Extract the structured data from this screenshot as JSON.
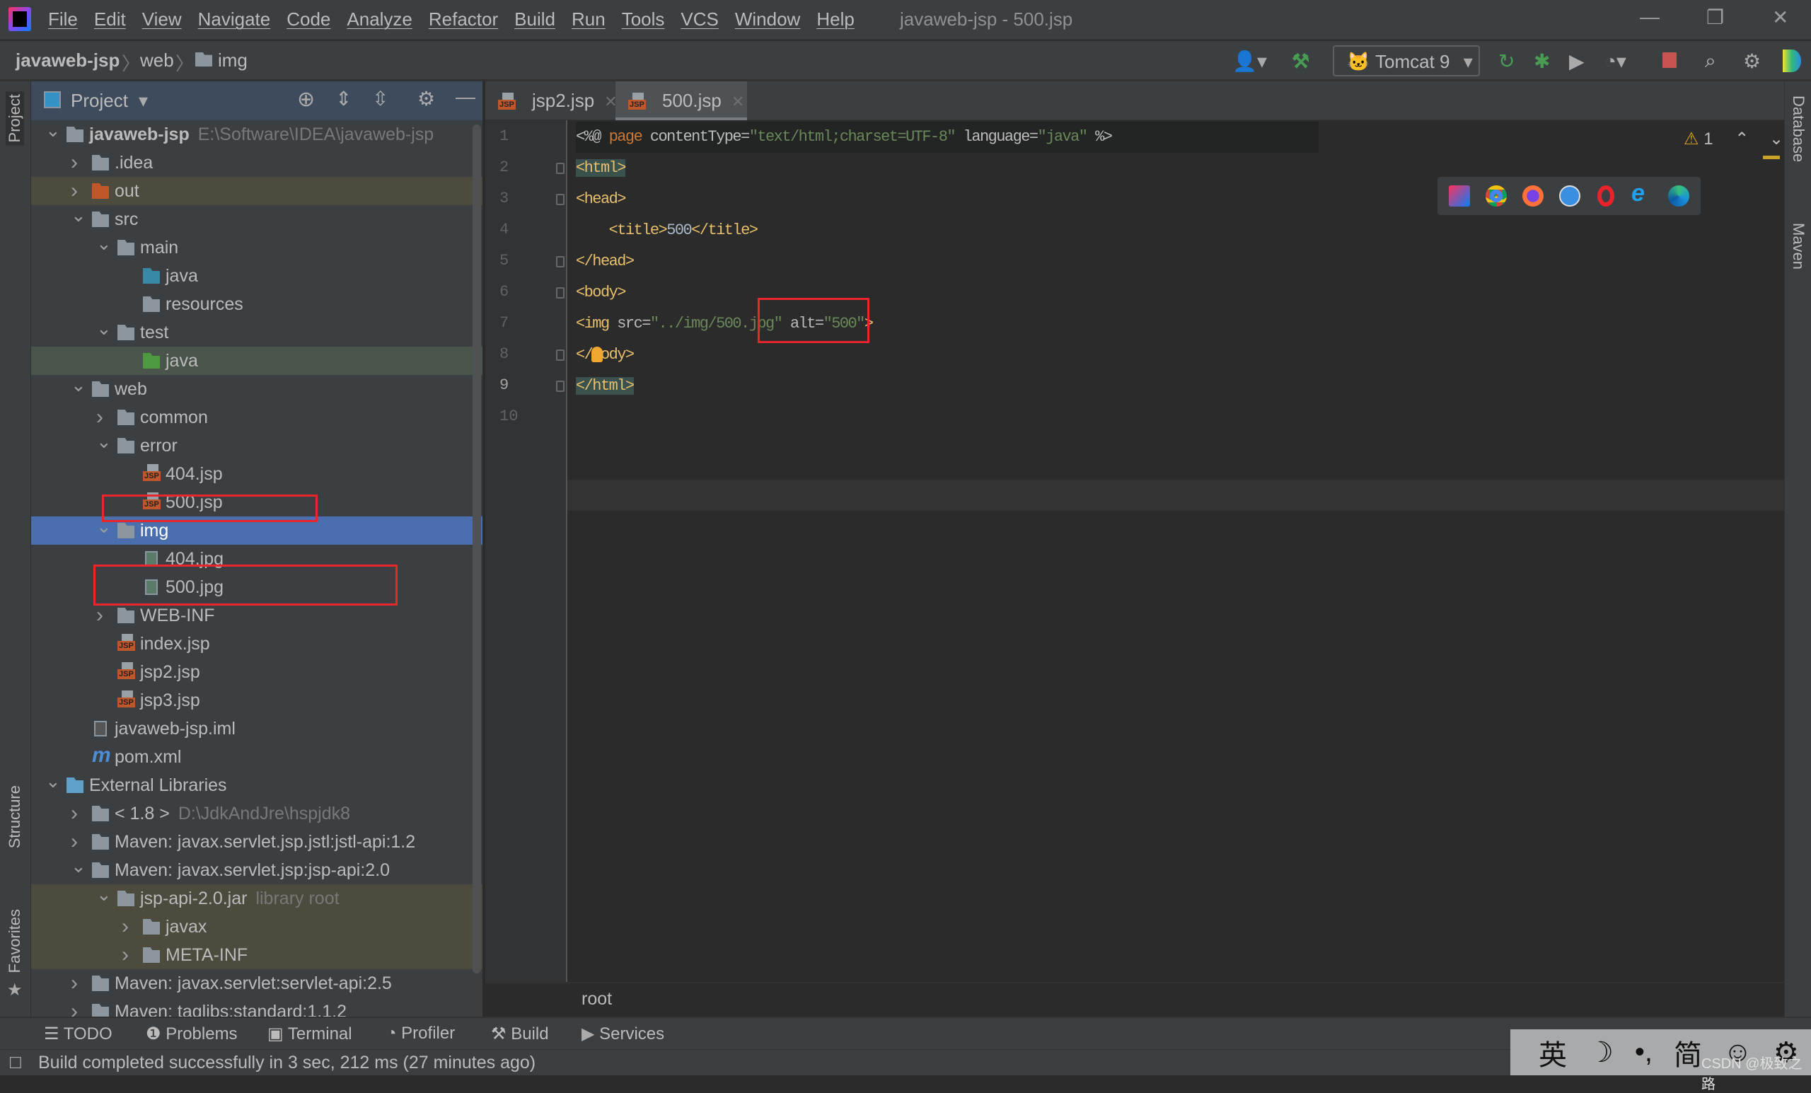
{
  "app": {
    "title": "javaweb-jsp - 500.jsp",
    "menu": [
      "File",
      "Edit",
      "View",
      "Navigate",
      "Code",
      "Analyze",
      "Refactor",
      "Build",
      "Run",
      "Tools",
      "VCS",
      "Window",
      "Help"
    ]
  },
  "breadcrumb": [
    "javaweb-jsp",
    "web",
    "img"
  ],
  "toolbar": {
    "run_config": "Tomcat 9"
  },
  "side_left": [
    "Project",
    "Structure",
    "Favorites"
  ],
  "side_right": [
    "Database",
    "Maven"
  ],
  "project_panel": {
    "title": "Project"
  },
  "tree": [
    {
      "label": "javaweb-jsp",
      "hint": "E:\\Software\\IDEA\\javaweb-jsp",
      "level": 0,
      "arrow": "open",
      "icon": "module-folder",
      "bold": true
    },
    {
      "label": ".idea",
      "level": 1,
      "arrow": "closed",
      "icon": "folder"
    },
    {
      "label": "out",
      "level": 1,
      "arrow": "closed",
      "icon": "excluded-folder",
      "highlight": "brown"
    },
    {
      "label": "src",
      "level": 1,
      "arrow": "open",
      "icon": "folder"
    },
    {
      "label": "main",
      "level": 2,
      "arrow": "open",
      "icon": "folder"
    },
    {
      "label": "java",
      "level": 3,
      "arrow": "",
      "icon": "source-folder"
    },
    {
      "label": "resources",
      "level": 3,
      "arrow": "",
      "icon": "resources-folder"
    },
    {
      "label": "test",
      "level": 2,
      "arrow": "open",
      "icon": "folder"
    },
    {
      "label": "java",
      "level": 3,
      "arrow": "",
      "icon": "test-folder",
      "highlight": "green"
    },
    {
      "label": "web",
      "level": 1,
      "arrow": "open",
      "icon": "web-folder"
    },
    {
      "label": "common",
      "level": 2,
      "arrow": "closed",
      "icon": "folder"
    },
    {
      "label": "error",
      "level": 2,
      "arrow": "open",
      "icon": "folder"
    },
    {
      "label": "404.jsp",
      "level": 3,
      "arrow": "",
      "icon": "jsp-file"
    },
    {
      "label": "500.jsp",
      "level": 3,
      "arrow": "",
      "icon": "jsp-file"
    },
    {
      "label": "img",
      "level": 2,
      "arrow": "open",
      "icon": "folder",
      "highlight": "selected"
    },
    {
      "label": "404.jpg",
      "level": 3,
      "arrow": "",
      "icon": "image-file"
    },
    {
      "label": "500.jpg",
      "level": 3,
      "arrow": "",
      "icon": "image-file"
    },
    {
      "label": "WEB-INF",
      "level": 2,
      "arrow": "closed",
      "icon": "folder"
    },
    {
      "label": "index.jsp",
      "level": 2,
      "arrow": "",
      "icon": "jsp-file"
    },
    {
      "label": "jsp2.jsp",
      "level": 2,
      "arrow": "",
      "icon": "jsp-file"
    },
    {
      "label": "jsp3.jsp",
      "level": 2,
      "arrow": "",
      "icon": "jsp-file"
    },
    {
      "label": "javaweb-jsp.iml",
      "level": 1,
      "arrow": "",
      "icon": "iml-file"
    },
    {
      "label": "pom.xml",
      "level": 1,
      "arrow": "",
      "icon": "maven-file"
    },
    {
      "label": "External Libraries",
      "level": 0,
      "arrow": "open",
      "icon": "libraries"
    },
    {
      "label": "< 1.8 >",
      "hint": "D:\\JdkAndJre\\hspjdk8",
      "level": 1,
      "arrow": "closed",
      "icon": "jdk"
    },
    {
      "label": "Maven: javax.servlet.jsp.jstl:jstl-api:1.2",
      "level": 1,
      "arrow": "closed",
      "icon": "library"
    },
    {
      "label": "Maven: javax.servlet.jsp:jsp-api:2.0",
      "level": 1,
      "arrow": "open",
      "icon": "library"
    },
    {
      "label": "jsp-api-2.0.jar",
      "hint": "library root",
      "level": 2,
      "arrow": "open",
      "icon": "jar",
      "highlight": "brown"
    },
    {
      "label": "javax",
      "level": 3,
      "arrow": "closed",
      "icon": "folder",
      "highlight": "brown"
    },
    {
      "label": "META-INF",
      "level": 3,
      "arrow": "closed",
      "icon": "folder",
      "highlight": "brown"
    },
    {
      "label": "Maven: javax.servlet:servlet-api:2.5",
      "level": 1,
      "arrow": "closed",
      "icon": "library"
    },
    {
      "label": "Maven: taglibs:standard:1.1.2",
      "level": 1,
      "arrow": "closed",
      "icon": "library"
    }
  ],
  "tabs": [
    {
      "label": "jsp2.jsp",
      "active": false
    },
    {
      "label": "500.jsp",
      "active": true
    }
  ],
  "editor": {
    "warnings": "1",
    "lines": [
      [
        [
          "<%@ ",
          "dir"
        ],
        [
          "page",
          "kw"
        ],
        [
          " contentType=",
          "dir"
        ],
        [
          "\"text/html;charset=UTF-8\"",
          "str"
        ],
        [
          " language=",
          "dir"
        ],
        [
          "\"java\"",
          "str"
        ],
        [
          " %>",
          "dir"
        ]
      ],
      [
        [
          "<html>",
          "tag"
        ]
      ],
      [
        [
          "<head>",
          "tag"
        ]
      ],
      [
        [
          "    <title>",
          "tag"
        ],
        [
          "500",
          "txt"
        ],
        [
          "</title>",
          "tag"
        ]
      ],
      [
        [
          "</head>",
          "tag"
        ]
      ],
      [
        [
          "<body>",
          "tag"
        ]
      ],
      [
        [
          "<img ",
          "tag"
        ],
        [
          "src=",
          "attr"
        ],
        [
          "\"../img/500.jpg\"",
          "str"
        ],
        [
          " alt=",
          "attr"
        ],
        [
          "\"500\"",
          "str"
        ],
        [
          ">",
          "tag"
        ]
      ],
      [
        [
          "</body>",
          "tag"
        ]
      ],
      [
        [
          "</html>",
          "tag"
        ]
      ],
      []
    ],
    "breadcrumb": "root"
  },
  "bottom_tools": [
    "TODO",
    "Problems",
    "Terminal",
    "Profiler",
    "Build",
    "Services"
  ],
  "status": "Build completed successfully in 3 sec, 212 ms (27 minutes ago)",
  "ime": [
    "英",
    "☽",
    "•,",
    "简",
    "☺",
    "⚙"
  ],
  "watermark": "CSDN @极致之路",
  "colors": {
    "highlight_box": "#e8262b",
    "selection": "#4b6eaf",
    "accent_tag": "#e8bf6a",
    "string": "#6a8759"
  }
}
